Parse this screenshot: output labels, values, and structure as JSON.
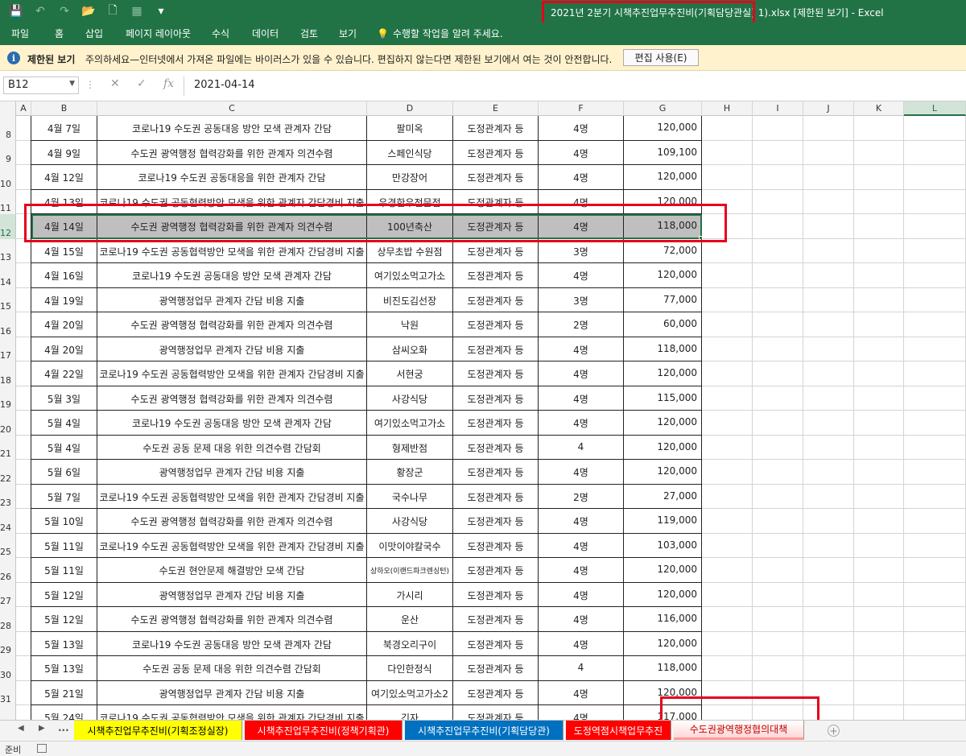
{
  "window": {
    "title": "2021년 2분기 시책추진업무추진비(기획담당관실)",
    "title_suffix": "1).xlsx  [제한된 보기]  - Excel"
  },
  "quick_access": [
    {
      "icon": "save-icon",
      "glyph": "💾"
    },
    {
      "icon": "undo-icon",
      "glyph": "↶"
    },
    {
      "icon": "redo-icon",
      "glyph": "↷"
    },
    {
      "icon": "open-folder-icon",
      "glyph": "📂"
    },
    {
      "icon": "new-file-icon",
      "glyph": "🗋"
    },
    {
      "icon": "form-icon",
      "glyph": "▦"
    },
    {
      "icon": "customize-icon",
      "glyph": "▾"
    }
  ],
  "ribbon": {
    "tabs": [
      "파일",
      "홈",
      "삽입",
      "페이지 레이아웃",
      "수식",
      "데이터",
      "검토",
      "보기"
    ],
    "tell_me": "수행할 작업을 알려 주세요."
  },
  "protected_view": {
    "label": "제한된 보기",
    "message": "주의하세요—인터넷에서 가져온 파일에는 바이러스가 있을 수 있습니다. 편집하지 않는다면 제한된 보기에서 여는 것이 안전합니다.",
    "button": "편집 사용(E)"
  },
  "formula_bar": {
    "name_box": "B12",
    "fx": "fx",
    "cancel": "✕",
    "enter": "✓",
    "value": "2021-04-14"
  },
  "columns": [
    "A",
    "B",
    "C",
    "D",
    "E",
    "F",
    "G",
    "H",
    "I",
    "J",
    "K",
    "L"
  ],
  "selected_column": "L",
  "selected_row": "12",
  "rows": [
    {
      "row": "8",
      "date": "4월 7일",
      "purpose": "코로나19 수도권 공동대응 방안 모색 관계자 간담",
      "place": "팔미옥",
      "target": "도정관계자 등",
      "people": "4명",
      "amount": "120,000"
    },
    {
      "row": "9",
      "date": "4월 9일",
      "purpose": "수도권 광역행정 협력강화를 위한 관계자 의견수렴",
      "place": "스페인식당",
      "target": "도정관계자 등",
      "people": "4명",
      "amount": "109,100"
    },
    {
      "row": "10",
      "date": "4월 12일",
      "purpose": "코로나19 수도권 공동대응을 위한 관계자 간담",
      "place": "만강장어",
      "target": "도정관계자 등",
      "people": "4명",
      "amount": "120,000"
    },
    {
      "row": "11",
      "date": "4월 13일",
      "purpose": "코로나19 수도권 공동협력방안 모색을 위한 관계자 간담경비 지출",
      "place": "우경한우전문점",
      "target": "도정관계자 등",
      "people": "4명",
      "amount": "120,000"
    },
    {
      "row": "12",
      "date": "4월 14일",
      "purpose": "수도권 광역행정 협력강화를 위한 관계자 의견수렴",
      "place": "100년축산",
      "target": "도정관계자 등",
      "people": "4명",
      "amount": "118,000"
    },
    {
      "row": "13",
      "date": "4월 15일",
      "purpose": "코로나19 수도권 공동협력방안 모색을 위한 관계자 간담경비 지출",
      "place": "상무초밥 수원점",
      "target": "도정관계자 등",
      "people": "3명",
      "amount": "72,000"
    },
    {
      "row": "14",
      "date": "4월 16일",
      "purpose": "코로나19 수도권 공동대응 방안 모색 관계자 간담",
      "place": "여기있소먹고가소",
      "target": "도정관계자 등",
      "people": "4명",
      "amount": "120,000"
    },
    {
      "row": "15",
      "date": "4월 19일",
      "purpose": "광역행정업무 관계자 간담 비용 지출",
      "place": "비진도김선장",
      "target": "도정관계자 등",
      "people": "3명",
      "amount": "77,000"
    },
    {
      "row": "16",
      "date": "4월 20일",
      "purpose": "수도권 광역행정 협력강화를 위한 관계자 의견수렴",
      "place": "낙원",
      "target": "도정관계자 등",
      "people": "2명",
      "amount": "60,000"
    },
    {
      "row": "17",
      "date": "4월 20일",
      "purpose": "광역행정업무 관계자 간담 비용 지출",
      "place": "삼씨오화",
      "target": "도정관계자 등",
      "people": "4명",
      "amount": "118,000"
    },
    {
      "row": "18",
      "date": "4월 22일",
      "purpose": "코로나19 수도권 공동협력방안 모색을 위한 관계자 간담경비 지출",
      "place": "서현궁",
      "target": "도정관계자 등",
      "people": "4명",
      "amount": "120,000"
    },
    {
      "row": "19",
      "date": "5월 3일",
      "purpose": "수도권 광역행정 협력강화를 위한 관계자 의견수렴",
      "place": "사강식당",
      "target": "도정관계자 등",
      "people": "4명",
      "amount": "115,000"
    },
    {
      "row": "20",
      "date": "5월 4일",
      "purpose": "코로나19 수도권 공동대응 방안 모색 관계자 간담",
      "place": "여기있소먹고가소",
      "target": "도정관계자 등",
      "people": "4명",
      "amount": "120,000"
    },
    {
      "row": "21",
      "date": "5월 4일",
      "purpose": "수도권 공동 문제 대응 위한 의견수렴 간담회",
      "place": "형제반점",
      "target": "도정관계자 등",
      "people": "4",
      "amount": "120,000"
    },
    {
      "row": "22",
      "date": "5월 6일",
      "purpose": "광역행정업무 관계자 간담 비용 지출",
      "place": "황장군",
      "target": "도정관계자 등",
      "people": "4명",
      "amount": "120,000"
    },
    {
      "row": "23",
      "date": "5월 7일",
      "purpose": "코로나19 수도권 공동협력방안 모색을 위한 관계자 간담경비 지출",
      "place": "국수나무",
      "target": "도정관계자 등",
      "people": "2명",
      "amount": "27,000"
    },
    {
      "row": "24",
      "date": "5월 10일",
      "purpose": "수도권 광역행정 협력강화를 위한 관계자 의견수렴",
      "place": "사강식당",
      "target": "도정관계자 등",
      "people": "4명",
      "amount": "119,000"
    },
    {
      "row": "25",
      "date": "5월 11일",
      "purpose": "코로나19 수도권 공동협력방안 모색을 위한 관계자 간담경비 지출",
      "place": "이맛이야칼국수",
      "target": "도정관계자 등",
      "people": "4명",
      "amount": "103,000"
    },
    {
      "row": "26",
      "date": "5월 11일",
      "purpose": "수도권 현안문제 해결방안 모색 간담",
      "place": "상하오(이랜드파크렌싱턴)",
      "target": "도정관계자 등",
      "people": "4명",
      "amount": "120,000",
      "small_place": true
    },
    {
      "row": "27",
      "date": "5월 12일",
      "purpose": "광역행정업무 관계자 간담 비용 지출",
      "place": "가시리",
      "target": "도정관계자 등",
      "people": "4명",
      "amount": "120,000"
    },
    {
      "row": "28",
      "date": "5월 12일",
      "purpose": "수도권 광역행정 협력강화를 위한 관계자 의견수렴",
      "place": "운산",
      "target": "도정관계자 등",
      "people": "4명",
      "amount": "116,000"
    },
    {
      "row": "29",
      "date": "5월 13일",
      "purpose": "코로나19 수도권 공동대응 방안 모색 관계자 간담",
      "place": "북경오리구이",
      "target": "도정관계자 등",
      "people": "4명",
      "amount": "120,000"
    },
    {
      "row": "30",
      "date": "5월 13일",
      "purpose": "수도권 공동 문제 대응 위한 의견수렴 간담회",
      "place": "다인한정식",
      "target": "도정관계자 등",
      "people": "4",
      "amount": "118,000"
    },
    {
      "row": "31",
      "date": "5월 21일",
      "purpose": "광역행정업무 관계자 간담 비용 지출",
      "place": "여기있소먹고가소2",
      "target": "도정관계자 등",
      "people": "4명",
      "amount": "120,000"
    },
    {
      "row": "32",
      "date": "5월 24일",
      "purpose": "코로나19 수도권 공동협력방안 모색을 위한 관계자 간담경비 지출",
      "place": "긴자",
      "target": "도정관계자 등",
      "people": "4명",
      "amount": "117,000"
    }
  ],
  "sheet_tabs": [
    {
      "label": "시책추진업무추진비(기획조정실장)",
      "bg": "#ffff00",
      "fg": "#000000"
    },
    {
      "label": "시책추진업무추진비(정책기획관)",
      "bg": "#ff0000",
      "fg": "#ffffff"
    },
    {
      "label": "시책추진업무추진비(기획담당관)",
      "bg": "#0070c0",
      "fg": "#ffffff"
    },
    {
      "label": "도정역점시책업무추진",
      "bg": "#ff0000",
      "fg": "#ffffff"
    },
    {
      "label": "수도권광역행정협의대책",
      "bg": "#ffffff",
      "fg": "#c00000",
      "active": true
    }
  ],
  "sheet_nav": {
    "prev": "◀",
    "next": "▶",
    "more": "..."
  },
  "status": {
    "ready": "준비"
  },
  "colors": {
    "excel_green": "#217346",
    "protected_bar": "#fff2cc",
    "highlight": "#e6001c",
    "selected_row": "#bfbfbf"
  }
}
